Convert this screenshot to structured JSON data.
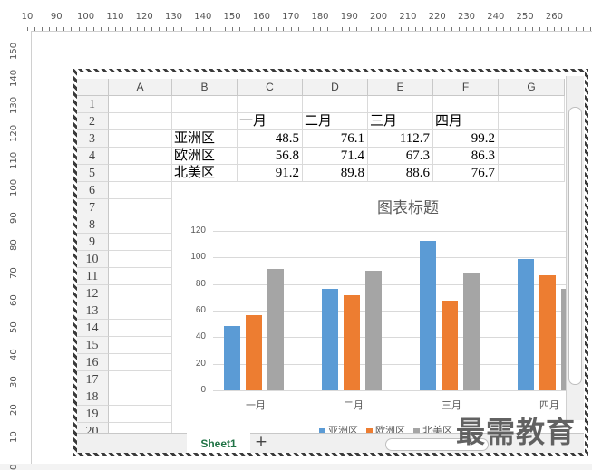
{
  "ruler": {
    "top_labels": [
      "10",
      "90",
      "100",
      "110",
      "120",
      "130",
      "140",
      "150",
      "160",
      "170",
      "180",
      "190",
      "200",
      "210",
      "220",
      "230",
      "240",
      "250",
      "260"
    ],
    "left_labels": [
      "150",
      "140",
      "130",
      "120",
      "110",
      "100",
      "90",
      "80",
      "70",
      "60",
      "50",
      "40",
      "30",
      "20",
      "10",
      "0"
    ]
  },
  "sheet": {
    "columns": [
      "A",
      "B",
      "C",
      "D",
      "E",
      "F",
      "G"
    ],
    "rows": [
      "1",
      "2",
      "3",
      "4",
      "5",
      "6",
      "7",
      "8",
      "9",
      "10",
      "11",
      "12",
      "13",
      "14",
      "15",
      "16",
      "17",
      "18",
      "19",
      "20"
    ],
    "header_row": [
      "一月",
      "二月",
      "三月",
      "四月"
    ],
    "data": [
      {
        "region": "亚洲区",
        "values": [
          "48.5",
          "76.1",
          "112.7",
          "99.2"
        ]
      },
      {
        "region": "欧洲区",
        "values": [
          "56.8",
          "71.4",
          "67.3",
          "86.3"
        ]
      },
      {
        "region": "北美区",
        "values": [
          "91.2",
          "89.8",
          "88.6",
          "76.7"
        ]
      }
    ]
  },
  "chart_data": {
    "type": "bar",
    "title": "图表标题",
    "categories": [
      "一月",
      "二月",
      "三月",
      "四月"
    ],
    "series": [
      {
        "name": "亚洲区",
        "values": [
          48.5,
          76.1,
          112.7,
          99.2
        ],
        "color": "#5b9bd5"
      },
      {
        "name": "欧洲区",
        "values": [
          56.8,
          71.4,
          67.3,
          86.3
        ],
        "color": "#ed7d31"
      },
      {
        "name": "北美区",
        "values": [
          91.2,
          89.8,
          88.6,
          76.7
        ],
        "color": "#a5a5a5"
      }
    ],
    "ylim": [
      0,
      120
    ],
    "yticks": [
      "0",
      "20",
      "40",
      "60",
      "80",
      "100",
      "120"
    ],
    "grid": true,
    "legend_position": "bottom"
  },
  "tabs": {
    "sheet_name": "Sheet1",
    "add_label": "+"
  },
  "watermark": "最需教育"
}
